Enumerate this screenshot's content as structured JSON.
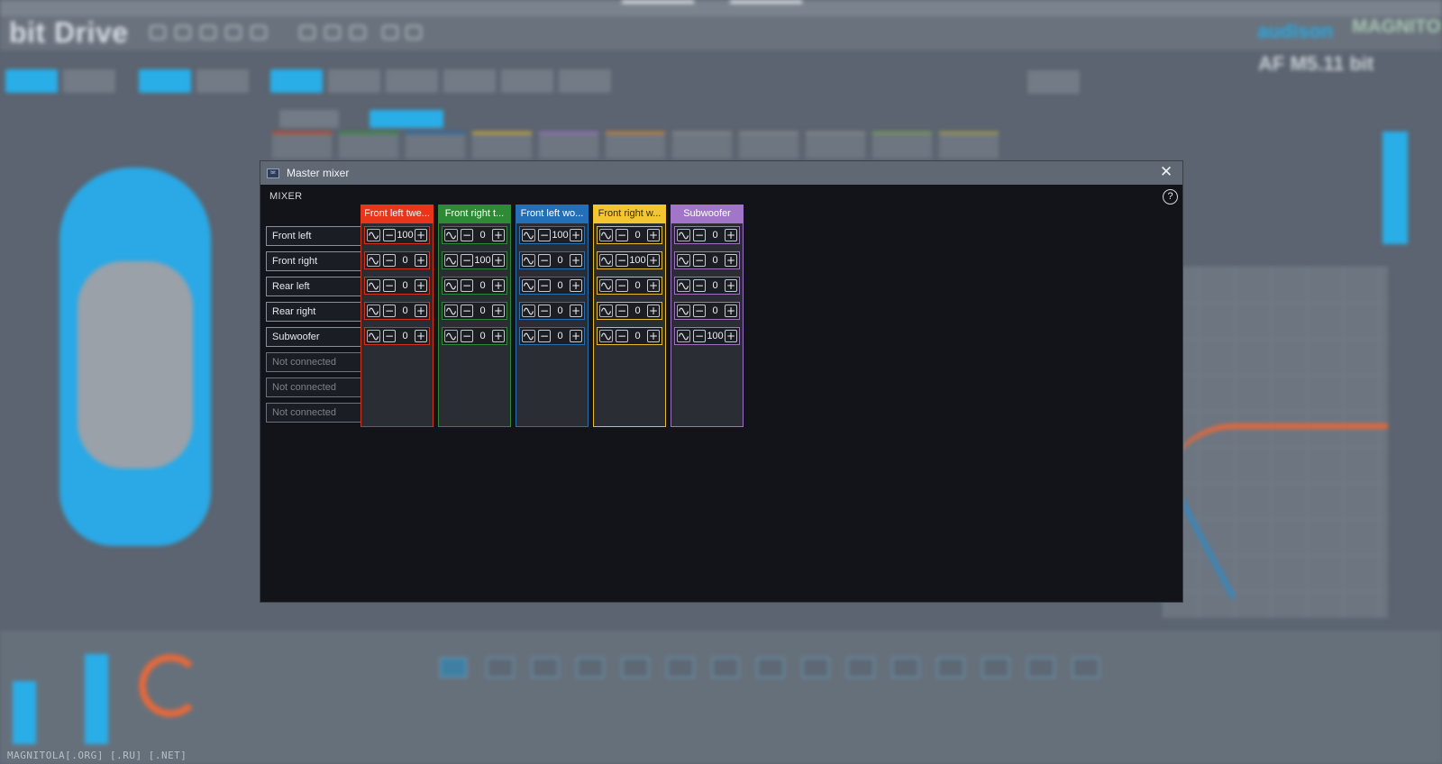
{
  "background": {
    "app_name": "bit Drive",
    "brand": "audison",
    "model": "AF M5.11 bit",
    "watermark_top": "MAGNITOLA",
    "watermark_bottom": "MAGNITOLA[.ORG] [.RU] [.NET]"
  },
  "dialog": {
    "title": "Master mixer",
    "icon_text": "bit",
    "close_label": "✕",
    "section_label": "MIXER",
    "help_label": "?"
  },
  "inputs": [
    {
      "label": "Front left",
      "connected": true
    },
    {
      "label": "Front right",
      "connected": true
    },
    {
      "label": "Rear left",
      "connected": true
    },
    {
      "label": "Rear right",
      "connected": true
    },
    {
      "label": "Subwoofer",
      "connected": true
    },
    {
      "label": "Not connected",
      "connected": false
    },
    {
      "label": "Not connected",
      "connected": false
    },
    {
      "label": "Not connected",
      "connected": false
    }
  ],
  "outputs": [
    {
      "label": "Front left twe...",
      "header_color": "#e8361a",
      "text_color": "#ffffff",
      "border_color": "#d2331c",
      "values": [
        "100",
        "0",
        "0",
        "0",
        "0"
      ]
    },
    {
      "label": "Front right t...",
      "header_color": "#2f8a36",
      "text_color": "#ffffff",
      "border_color": "#2f8a36",
      "values": [
        "0",
        "100",
        "0",
        "0",
        "0"
      ]
    },
    {
      "label": "Front left wo...",
      "header_color": "#2470b8",
      "text_color": "#ffffff",
      "border_color": "#2a6fb0",
      "values": [
        "100",
        "0",
        "0",
        "0",
        "0"
      ]
    },
    {
      "label": "Front right w...",
      "header_color": "#f2c531",
      "text_color": "#2a2a2a",
      "border_color": "#e6bb2e",
      "values": [
        "0",
        "100",
        "0",
        "0",
        "0"
      ]
    },
    {
      "label": "Subwoofer",
      "header_color": "#a176c9",
      "text_color": "#ffffff",
      "border_color": "#9b73c2",
      "values": [
        "0",
        "0",
        "0",
        "0",
        "100"
      ]
    }
  ],
  "controls": {
    "phase_icon": "sine-wave-icon",
    "minus_label": "−",
    "plus_label": "+"
  }
}
